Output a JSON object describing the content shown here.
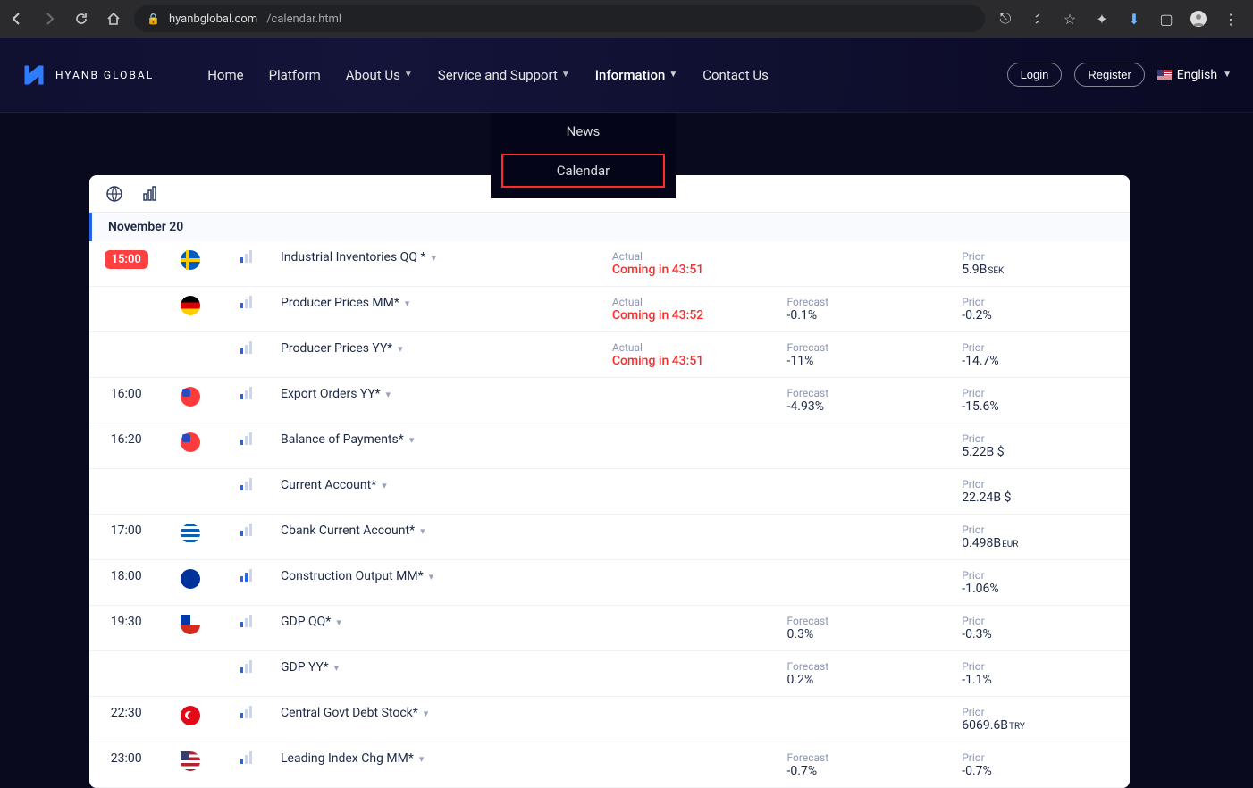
{
  "browser": {
    "url_host": "hyanbglobal.com",
    "url_path": "/calendar.html"
  },
  "header": {
    "brand": "HYANB GLOBAL",
    "nav": [
      "Home",
      "Platform",
      "About Us",
      "Service and Support",
      "Information",
      "Contact Us"
    ],
    "login": "Login",
    "register": "Register",
    "language": "English"
  },
  "dropdown": {
    "item1": "News",
    "item2": "Calendar"
  },
  "calendar": {
    "date": "November 20",
    "labels": {
      "actual": "Actual",
      "forecast": "Forecast",
      "prior": "Prior"
    },
    "rows": [
      {
        "time": "15:00",
        "live": true,
        "flag": "se",
        "importance": 1,
        "name": "Industrial Inventories QQ *",
        "actual": "Coming in 43:51",
        "actual_red": true,
        "forecast": "",
        "prior": "5.9B",
        "prior_unit": "SEK"
      },
      {
        "time": "",
        "live": false,
        "flag": "de",
        "importance": 1,
        "name": "Producer Prices MM*",
        "actual": "Coming in 43:52",
        "actual_red": true,
        "forecast": "-0.1%",
        "prior": "-0.2%",
        "prior_unit": ""
      },
      {
        "time": "",
        "live": false,
        "flag": "",
        "importance": 1,
        "name": "Producer Prices YY*",
        "actual": "Coming in 43:51",
        "actual_red": true,
        "forecast": "-11%",
        "prior": "-14.7%",
        "prior_unit": ""
      },
      {
        "time": "16:00",
        "live": false,
        "flag": "tw",
        "importance": 1,
        "name": "Export Orders YY*",
        "actual": "",
        "actual_red": false,
        "forecast": "-4.93%",
        "prior": "-15.6%",
        "prior_unit": ""
      },
      {
        "time": "16:20",
        "live": false,
        "flag": "tw",
        "importance": 1,
        "name": "Balance of Payments*",
        "actual": "",
        "actual_red": false,
        "forecast": "",
        "prior": "5.22B $",
        "prior_unit": ""
      },
      {
        "time": "",
        "live": false,
        "flag": "",
        "importance": 1,
        "name": "Current Account*",
        "actual": "",
        "actual_red": false,
        "forecast": "",
        "prior": "22.24B $",
        "prior_unit": ""
      },
      {
        "time": "17:00",
        "live": false,
        "flag": "gr",
        "importance": 1,
        "name": "Cbank Current Account*",
        "actual": "",
        "actual_red": false,
        "forecast": "",
        "prior": "0.498B",
        "prior_unit": "EUR"
      },
      {
        "time": "18:00",
        "live": false,
        "flag": "eu",
        "importance": 2,
        "name": "Construction Output MM*",
        "actual": "",
        "actual_red": false,
        "forecast": "",
        "prior": "-1.06%",
        "prior_unit": ""
      },
      {
        "time": "19:30",
        "live": false,
        "flag": "cl",
        "importance": 1,
        "name": "GDP QQ*",
        "actual": "",
        "actual_red": false,
        "forecast": "0.3%",
        "prior": "-0.3%",
        "prior_unit": ""
      },
      {
        "time": "",
        "live": false,
        "flag": "",
        "importance": 1,
        "name": "GDP YY*",
        "actual": "",
        "actual_red": false,
        "forecast": "0.2%",
        "prior": "-1.1%",
        "prior_unit": ""
      },
      {
        "time": "22:30",
        "live": false,
        "flag": "tr",
        "importance": 1,
        "name": "Central Govt Debt Stock*",
        "actual": "",
        "actual_red": false,
        "forecast": "",
        "prior": "6069.6B",
        "prior_unit": "TRY"
      },
      {
        "time": "23:00",
        "live": false,
        "flag": "us",
        "importance": 1,
        "name": "Leading Index Chg MM*",
        "actual": "",
        "actual_red": false,
        "forecast": "-0.7%",
        "prior": "-0.7%",
        "prior_unit": ""
      }
    ]
  }
}
